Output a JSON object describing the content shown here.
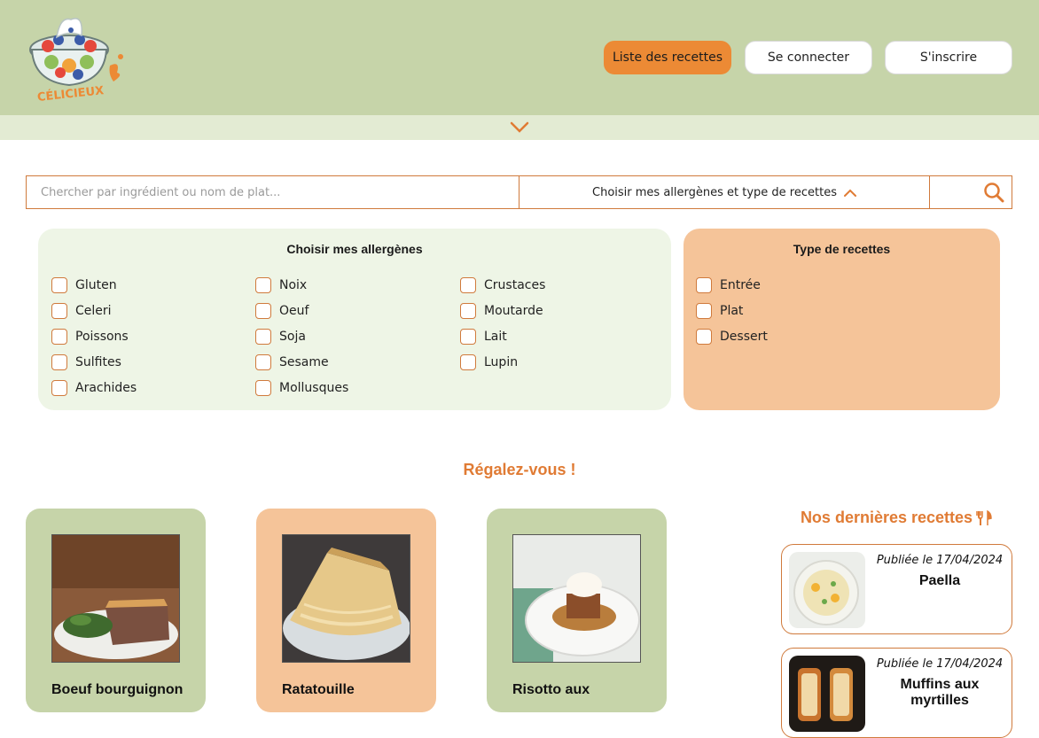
{
  "header": {
    "logo_text": "CÉLICIEUX",
    "nav": {
      "recipes_list": "Liste des recettes",
      "login": "Se connecter",
      "signup": "S'inscrire"
    }
  },
  "search": {
    "placeholder": "Chercher par ingrédient ou nom de plat...",
    "filter_toggle_label": "Choisir mes allergènes et type de recettes"
  },
  "allergens": {
    "title": "Choisir mes allergènes",
    "items": [
      "Gluten",
      "Celeri",
      "Poissons",
      "Sulfites",
      "Arachides",
      "Noix",
      "Oeuf",
      "Soja",
      "Sesame",
      "Mollusques",
      "Crustaces",
      "Moutarde",
      "Lait",
      "Lupin"
    ]
  },
  "recipe_types": {
    "title": "Type de recettes",
    "items": [
      "Entrée",
      "Plat",
      "Dessert"
    ]
  },
  "main": {
    "section_title": "Régalez-vous !",
    "cards": [
      {
        "title": "Boeuf bourguignon"
      },
      {
        "title": "Ratatouille"
      },
      {
        "title": "Risotto aux"
      }
    ]
  },
  "latest": {
    "title": "Nos dernières recettes",
    "items": [
      {
        "date": "Publiée le 17/04/2024",
        "name": "Paella"
      },
      {
        "date": "Publiée le 17/04/2024",
        "name": "Muffins aux myrtilles"
      }
    ]
  },
  "colors": {
    "header_green": "#c6d4a9",
    "accent_orange": "#ec8a35",
    "title_orange": "#e07b34",
    "panel_light_green": "#eef5e6",
    "panel_peach": "#f5c499"
  }
}
